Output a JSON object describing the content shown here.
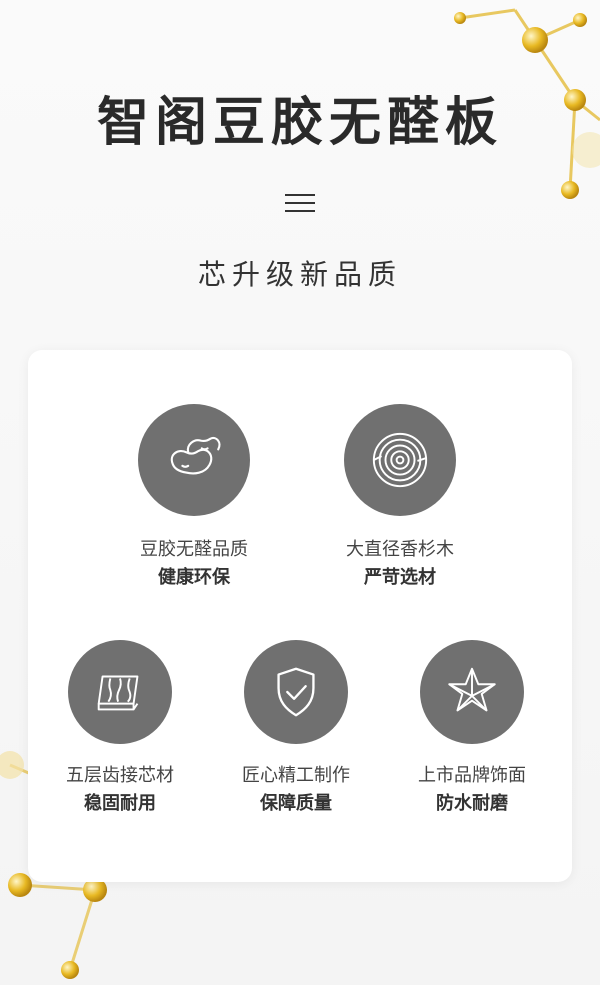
{
  "header": {
    "title": "智阁豆胶无醛板",
    "subtitle": "芯升级新品质"
  },
  "features": [
    {
      "label": "豆胶无醛品质",
      "sub": "健康环保",
      "icon": "bean-icon"
    },
    {
      "label": "大直径香杉木",
      "sub": "严苛选材",
      "icon": "tree-ring-icon"
    },
    {
      "label": "五层齿接芯材",
      "sub": "稳固耐用",
      "icon": "wood-board-icon"
    },
    {
      "label": "匠心精工制作",
      "sub": "保障质量",
      "icon": "shield-check-icon"
    },
    {
      "label": "上市品牌饰面",
      "sub": "防水耐磨",
      "icon": "star-icon"
    }
  ],
  "colors": {
    "circle": "#707070",
    "accent_gold": "#e8b923",
    "text": "#333333"
  }
}
